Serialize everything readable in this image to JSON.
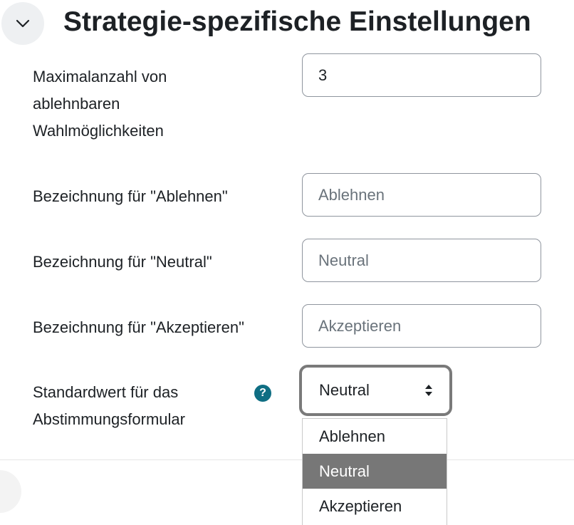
{
  "section": {
    "title": "Strategie-spezifische Einstellungen",
    "toggle_icon": "chevron-down-icon"
  },
  "fields": {
    "max_refusals": {
      "label": "Maximalanzahl von ablehnbaren Wahlmöglichkeiten",
      "value": "3"
    },
    "label_refuse": {
      "label": "Bezeichnung für \"Ablehnen\"",
      "placeholder": "Ablehnen"
    },
    "label_neutral": {
      "label": "Bezeichnung für \"Neutral\"",
      "placeholder": "Neutral"
    },
    "label_accept": {
      "label": "Bezeichnung für \"Akzeptieren\"",
      "placeholder": "Akzeptieren"
    },
    "default_value": {
      "label": "Standardwert für das Abstimmungsformular",
      "help_icon": "question-mark-icon",
      "help_symbol": "?",
      "selected": "Neutral",
      "options": [
        "Ablehnen",
        "Neutral",
        "Akzeptieren"
      ]
    }
  },
  "colors": {
    "help_icon": "#0f6e83",
    "selected_option_bg": "#777777",
    "focus_border": "#7a7a7a"
  }
}
